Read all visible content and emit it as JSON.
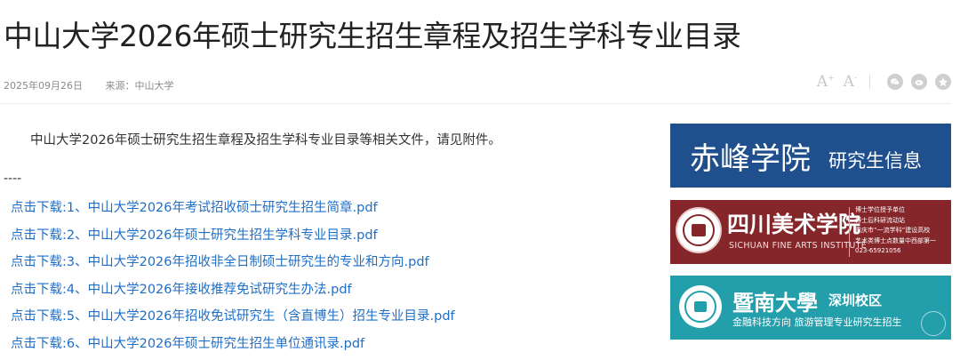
{
  "article": {
    "title": "中山大学2026年硕士研究生招生章程及招生学科专业目录",
    "date": "2025年09月26日",
    "source": "来源：中山大学",
    "intro": "中山大学2026年硕士研究生招生章程及招生学科专业目录等相关文件，请见附件。",
    "separator": "----",
    "attachments": [
      "点击下载:1、中山大学2026年考试招收硕士研究生招生简章.pdf",
      "点击下载:2、中山大学2026年硕士研究生招生学科专业目录.pdf",
      "点击下载:3、中山大学2026年招收非全日制硕士研究生的专业和方向.pdf",
      "点击下载:4、中山大学2026年接收推荐免试研究生办法.pdf",
      "点击下载:5、中山大学2026年招收免试研究生（含直博生）招生专业目录.pdf",
      "点击下载:6、中山大学2026年硕士研究生招生单位通讯录.pdf"
    ]
  },
  "toolbar": {
    "font_increase": "A",
    "font_decrease": "A",
    "share_icons": [
      "wechat-icon",
      "weibo-icon",
      "qzone-icon"
    ]
  },
  "ads": {
    "chifeng": {
      "big": "赤峰学院",
      "small": "研究生信息"
    },
    "sichuan": {
      "name_cn": "四川美术学院",
      "name_en": "SICHUAN FINE ARTS INSTITUTE",
      "side_lines": [
        "博士学位授予单位",
        "博士后科研流动站",
        "重庆市“一流学科”建设高校",
        "艺术类博士点数量中西部第一",
        "023-65921056"
      ]
    },
    "jinan": {
      "name": "暨南大學",
      "campus": "深圳校区",
      "sub": "金融科技方向 旅游管理专业研究生招生"
    }
  },
  "colors": {
    "link": "#1e6fc8",
    "chifeng_bg": "#1f4f8c",
    "sichuan_bg": "#84262a",
    "jinan_bg": "#239eab"
  }
}
